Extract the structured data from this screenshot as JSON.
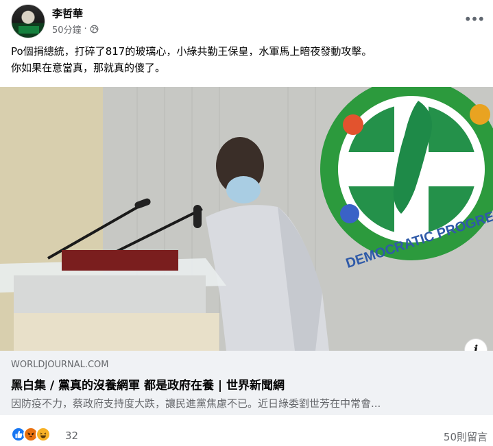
{
  "post": {
    "author": "李哲華",
    "time": "50分鐘",
    "separator": "·",
    "privacy_icon": "globe-icon",
    "more_icon": "more-options-icon",
    "text_line1": "Po個捐總統，打碎了817的玻璃心，小綠共勤王保皇，水軍馬上暗夜發動攻擊。",
    "text_line2": "你如果在意當真，那就真的傻了。"
  },
  "image": {
    "alt": "蔡英文 at podium in front of Democratic Progressive Party emblem",
    "logo_text": "DEMOCRATIC PROGRESSIVE PARTY",
    "info_label": "i"
  },
  "link": {
    "domain": "WORLDJOURNAL.COM",
    "title": "黑白集 / 黨真的沒養網軍 都是政府在養 | 世界新聞網",
    "description": "因防疫不力，蔡政府支持度大跌，讓民進黨焦慮不已。近日綠委劉世芳在中常會..."
  },
  "footer": {
    "reaction_icons": [
      "like-icon",
      "angry-icon",
      "haha-icon"
    ],
    "reaction_count": "32",
    "comments": "50則留言"
  },
  "colors": {
    "like": "#1877f2",
    "angry": "#e9710f",
    "haha": "#f7b125",
    "link_bg": "#f0f2f5",
    "secondary_text": "#65676b"
  }
}
